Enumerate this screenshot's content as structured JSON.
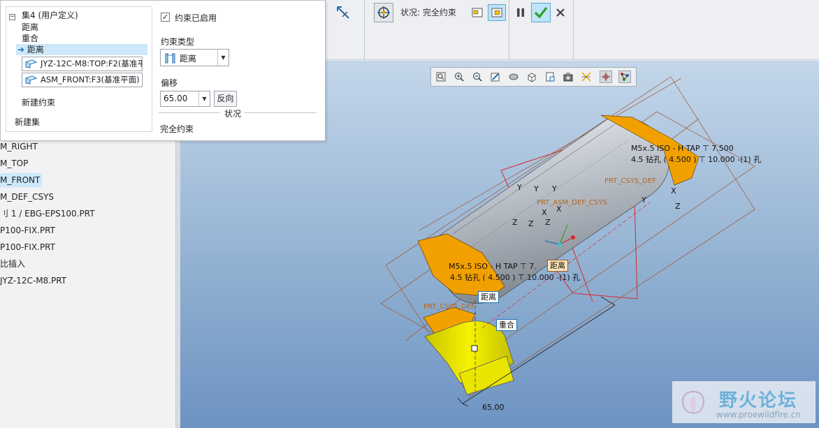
{
  "colors": {
    "accent": "#1c6fb8",
    "selection": "#cde8fb",
    "orange_part": "#f2a000",
    "yellow_part": "#f2ee00",
    "gray_part": "#b8bec6",
    "datum_red": "#d9282a",
    "confirm_green": "#2aa02a"
  },
  "ribbon": {
    "status_text": "状况: 完全约束",
    "icons": [
      "show-dimensions-icon",
      "move-component-icon",
      "separate-window-icon",
      "component-window-icon",
      "pause-icon",
      "confirm-icon",
      "cancel-icon"
    ]
  },
  "dialog": {
    "set_header": "集4 (用户定义)",
    "set_items": [
      "距离",
      "重合",
      "距离"
    ],
    "selected_item": "距离",
    "refs": [
      "JYZ-12C-M8:TOP:F2(基准平",
      "ASM_FRONT:F3(基准平面)"
    ],
    "new_constraint": "新建约束",
    "new_set": "新建集",
    "enabled_label": "约束已启用",
    "type_label": "约束类型",
    "type_value": "距离",
    "offset_label": "偏移",
    "offset_value": "65.00",
    "flip_label": "反向",
    "status_section": "状况",
    "status_value": "完全约束"
  },
  "tree": {
    "items": [
      "M_RIGHT",
      "M_TOP",
      "M_FRONT",
      "M_DEF_CSYS",
      "刂 1 / EBG-EPS100.PRT",
      "P100-FIX.PRT",
      "P100-FIX.PRT",
      "比插入",
      "JYZ-12C-M8.PRT"
    ],
    "selected_index": 2
  },
  "viewport": {
    "toolbar_icons": [
      "refit-icon",
      "zoom-in-icon",
      "zoom-out-icon",
      "repaint-icon",
      "display-style-icon",
      "saved-orientations-icon",
      "named-views-icon",
      "view-manager-icon",
      "datum-display-icon",
      "spin-center-icon",
      "annotation-display-icon"
    ],
    "annotations": {
      "hole_top_1": "M5x.5 ISO - H TAP ⊤ 7.500",
      "hole_top_2": "4.5 钻孔 ( 4.500 ) ⊤ 10.000  -(1) 孔",
      "hole_mid_1": "M5x.5 ISO - H TAP ⊤ 7.",
      "hole_mid_2": "4.5 钻孔 ( 4.500 ) ⊤ 10.000  -(1) 孔",
      "tag_distance_1": "距离",
      "tag_distance_2": "距离",
      "tag_coincident": "重合",
      "dim_value": "65.00",
      "csys_1": "PRT_CSYS_DEF",
      "csys_2": "PRT_ASM_DEF_CSYS",
      "csys_3": "PRT_CSYS_DEF",
      "axis_y": "Y",
      "axis_x": "X",
      "axis_z": "Z"
    }
  },
  "watermark": {
    "title": "野火论坛",
    "url": "www.proewildfire.cn"
  }
}
